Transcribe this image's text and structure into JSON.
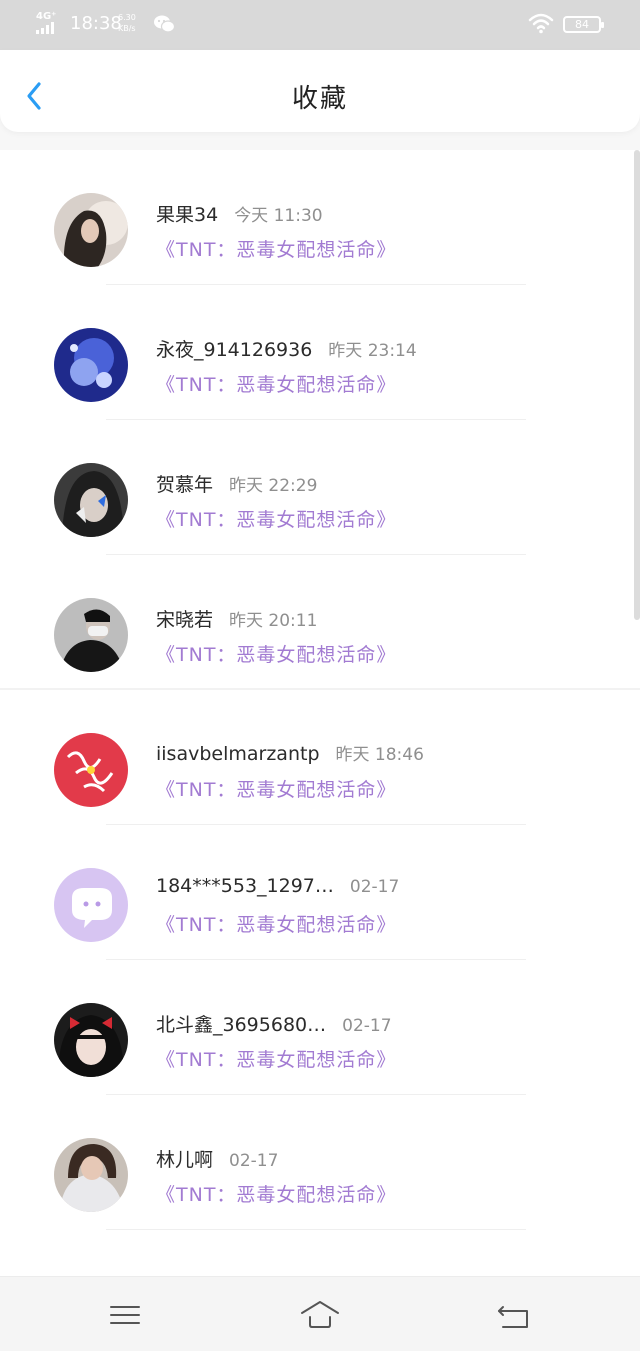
{
  "status_bar": {
    "network": "4G⁺",
    "time": "18:38",
    "speed_value": "6.30",
    "speed_unit": "KB/s",
    "battery": "84"
  },
  "header": {
    "title": "收藏",
    "back_icon": "chevron-left-icon"
  },
  "colors": {
    "accent": "#2a9df4",
    "book_title": "#a27bd2",
    "time": "#8f8f8f"
  },
  "favorites": [
    {
      "name": "果果34",
      "time": "今天 11:30",
      "book": "《TNT：恶毒女配想活命》",
      "avatar": "avatar-girl-dark-hair"
    },
    {
      "name": "永夜_914126936",
      "time": "昨天 23:14",
      "book": "《TNT：恶毒女配想活命》",
      "avatar": "avatar-blue-galaxy"
    },
    {
      "name": "贺慕年",
      "time": "昨天 22:29",
      "book": "《TNT：恶毒女配想活命》",
      "avatar": "avatar-boy-butterfly"
    },
    {
      "name": "宋晓若",
      "time": "昨天 20:11",
      "book": "《TNT：恶毒女配想活命》",
      "avatar": "avatar-boy-mask"
    },
    {
      "name": "iisavbelmarzantp",
      "time": "昨天 18:46",
      "book": "《TNT：恶毒女配想活命》",
      "avatar": "avatar-red-calligraphy"
    },
    {
      "name": "184***553_1297…",
      "time": "02-17",
      "book": "《TNT：恶毒女配想活命》",
      "avatar": "avatar-default-chat"
    },
    {
      "name": "北斗鑫_3695680…",
      "time": "02-17",
      "book": "《TNT：恶毒女配想活命》",
      "avatar": "avatar-girl-red-bow"
    },
    {
      "name": "林儿啊",
      "time": "02-17",
      "book": "《TNT：恶毒女配想活命》",
      "avatar": "avatar-girl-hood"
    }
  ],
  "nav": {
    "menu_icon": "menu-icon",
    "home_icon": "home-icon",
    "back_icon": "back-icon"
  }
}
